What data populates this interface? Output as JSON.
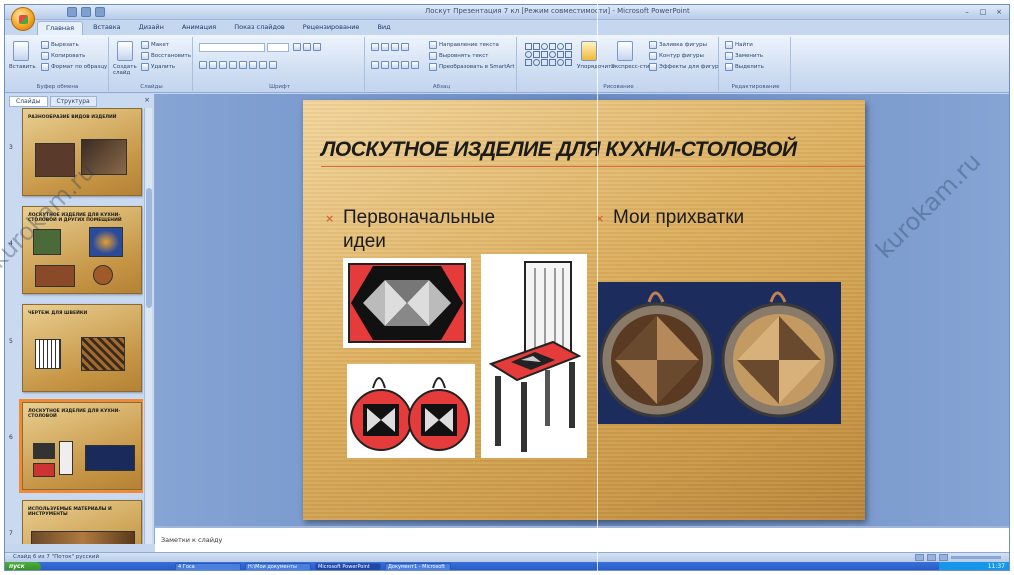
{
  "window": {
    "title": "Лоскут Презентация 7 кл [Режим совместимости] - Microsoft PowerPoint",
    "controls": [
      "–",
      "□",
      "×"
    ]
  },
  "ribbon": {
    "tabs": [
      "Главная",
      "Вставка",
      "Дизайн",
      "Анимация",
      "Показ слайдов",
      "Рецензирование",
      "Вид"
    ],
    "active_tab": "Главная",
    "groups": {
      "clipboard": {
        "label": "Буфер обмена",
        "paste": "Вставить",
        "cut": "Вырезать",
        "copy": "Копировать",
        "format": "Формат по образцу"
      },
      "slides": {
        "label": "Слайды",
        "new_slide": "Создать слайд",
        "layout": "Макет",
        "reset": "Восстановить",
        "delete": "Удалить"
      },
      "font": {
        "label": "Шрифт"
      },
      "paragraph": {
        "label": "Абзац",
        "direction": "Направление текста",
        "align": "Выровнять текст",
        "smartart": "Преобразовать в SmartArt"
      },
      "drawing": {
        "label": "Рисование",
        "arrange": "Упорядочить",
        "styles": "Экспресс-стили",
        "fill": "Заливка фигуры",
        "outline": "Контур фигуры",
        "effects": "Эффекты для фигур"
      },
      "editing": {
        "label": "Редактирование",
        "find": "Найти",
        "replace": "Заменить",
        "select": "Выделить"
      }
    }
  },
  "left_panel": {
    "tabs": [
      "Слайды",
      "Структура"
    ],
    "close": "×",
    "slides": [
      {
        "num": "3",
        "title": "Разнообразие видов изделий"
      },
      {
        "num": "4",
        "title": "Лоскутное изделие для кухни-столовой и других помещений"
      },
      {
        "num": "5",
        "title": "Чертеж для швейки"
      },
      {
        "num": "6",
        "title": "Лоскутное изделие для кухни-столовой"
      },
      {
        "num": "7",
        "title": "Используемые материалы и инструменты"
      }
    ]
  },
  "slide": {
    "title": "ЛОСКУТНОЕ ИЗДЕЛИЕ ДЛЯ КУХНИ-СТОЛОВОЙ",
    "bullet_mark": "×",
    "left_bullet": "Первоначальные идеи",
    "right_bullet": "Мои прихватки"
  },
  "notes": {
    "placeholder": "Заметки к слайду"
  },
  "status": {
    "text": "Слайд 6 из 7    \"Поток\"    русский"
  },
  "taskbar": {
    "start": "пуск",
    "items": [
      "4 Госа",
      "Н:\\Мои документы",
      "Microsoft PowerPoint",
      "Документ1 - Microsoft"
    ],
    "clock": "11:37"
  },
  "watermarks": [
    "kurokam.ru",
    "kurokam.ru"
  ]
}
